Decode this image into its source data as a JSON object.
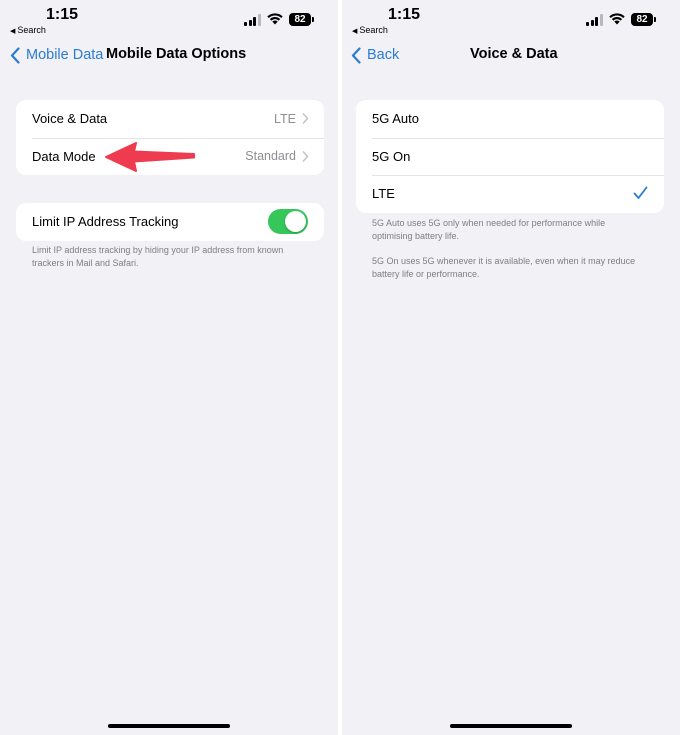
{
  "status_bar": {
    "time": "1:15",
    "back_app": "Search",
    "battery": "82"
  },
  "left_screen": {
    "nav": {
      "back_label": "Mobile Data",
      "title": "Mobile Data Options"
    },
    "group1": [
      {
        "label": "Voice & Data",
        "value": "LTE"
      },
      {
        "label": "Data Mode",
        "value": "Standard"
      }
    ],
    "group2": {
      "label": "Limit IP Address Tracking",
      "toggle_on": true
    },
    "footer": "Limit IP address tracking by hiding your IP address from known trackers in Mail and Safari."
  },
  "right_screen": {
    "nav": {
      "back_label": "Back",
      "title": "Voice & Data"
    },
    "options": [
      {
        "label": "5G Auto",
        "selected": false
      },
      {
        "label": "5G On",
        "selected": false
      },
      {
        "label": "LTE",
        "selected": true
      }
    ],
    "footer_1": "5G Auto uses 5G only when needed for performance while optimising battery life.",
    "footer_2": "5G On uses 5G whenever it is available, even when it may reduce battery life or performance."
  },
  "colors": {
    "accent": "#2a7bd4",
    "toggle_on": "#35c759",
    "annotation_arrow": "#ef3b4f",
    "background": "#f2f1f6"
  },
  "icons": [
    "chevron-left-icon",
    "chevron-right-icon",
    "checkmark-icon",
    "wifi-icon",
    "cellular-signal-icon",
    "battery-icon",
    "annotation-arrow-icon"
  ]
}
